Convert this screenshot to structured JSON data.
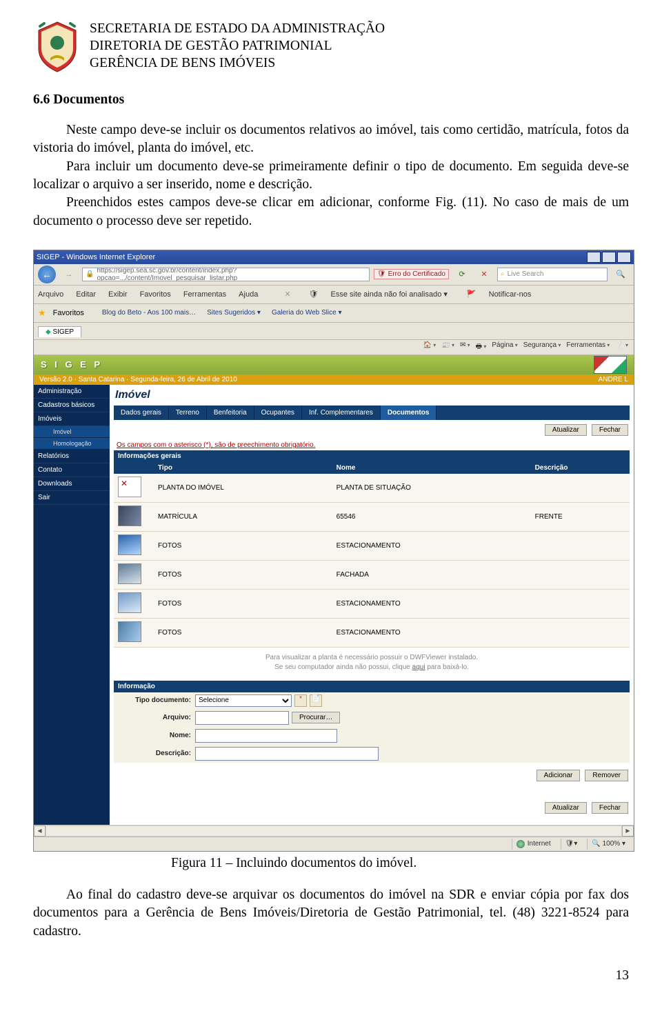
{
  "letterhead": {
    "line1": "SECRETARIA DE ESTADO DA ADMINISTRAÇÃO",
    "line2": "DIRETORIA DE GESTÃO PATRIMONIAL",
    "line3": "GERÊNCIA DE BENS IMÓVEIS"
  },
  "heading": "6.6 Documentos",
  "para1": "Neste campo deve-se incluir os documentos relativos ao imóvel, tais como certidão, matrícula, fotos da vistoria do imóvel, planta do imóvel, etc.",
  "para2a": "Para incluir um documento deve-se primeiramente definir o tipo de documento. Em seguida deve-se localizar o arquivo a ser inserido, nome e descrição.",
  "para2b": "Preenchidos estes campos deve-se clicar em adicionar, conforme Fig. (11). No caso de mais de um documento o processo deve ser repetido.",
  "caption": "Figura 11 – Incluindo documentos do imóvel.",
  "para3": "Ao final do cadastro deve-se arquivar os documentos do imóvel na SDR e enviar cópia por fax dos documentos para a Gerência de Bens Imóveis/Diretoria de Gestão Patrimonial, tel. (48) 3221-8524 para cadastro.",
  "pagenum": "13",
  "ie": {
    "title": "SIGEP - Windows Internet Explorer",
    "url": "https://sigep.sea.sc.gov.br/content/index.php?opcao=.../content/Imovel_pesquisar_listar.php",
    "cert": "Erro do Certificado",
    "search": "Live Search",
    "menu": {
      "arquivo": "Arquivo",
      "editar": "Editar",
      "exibir": "Exibir",
      "favoritos": "Favoritos",
      "ferramentas": "Ferramentas",
      "ajuda": "Ajuda"
    },
    "infobar": "Esse site ainda não foi analisado ▾",
    "notificar": "Notificar-nos",
    "favLabel": "Favoritos",
    "fav1": "Blog do Beto - Aos 100 mais…",
    "fav2": "Sites Sugeridos ▾",
    "fav3": "Galeria do Web Slice ▾",
    "tab": "SIGEP",
    "tools": {
      "pagina": "Página",
      "seguranca": "Segurança",
      "ferramentas": "Ferramentas"
    }
  },
  "sigep": {
    "brand": "S I G E P",
    "versionLine": "Versão 2.0  ·  Santa Catarina  ·  Segunda-feira, 26 de Abril de 2010",
    "user": "ANDRE L",
    "sidebar": [
      "Administração",
      "Cadastros básicos",
      "Imóveis",
      "Imóvel",
      "Homologação",
      "Relatórios",
      "Contato",
      "Downloads",
      "Sair"
    ],
    "pageTitle": "Imóvel",
    "tabs": [
      "Dados gerais",
      "Terreno",
      "Benfeitoria",
      "Ocupantes",
      "Inf. Complementares",
      "Documentos"
    ],
    "actions": {
      "atualizar": "Atualizar",
      "fechar": "Fechar"
    },
    "reqNote": "Os campos com o asterisco (*), são de preechimento obrigatório.",
    "sectInfo": "Informações gerais",
    "cols": {
      "tipo": "Tipo",
      "nome": "Nome",
      "descricao": "Descrição"
    },
    "rows": [
      {
        "tipo": "PLANTA DO IMÓVEL",
        "nome": "PLANTA DE SITUAÇÃO",
        "desc": ""
      },
      {
        "tipo": "MATRÍCULA",
        "nome": "65546",
        "desc": "FRENTE"
      },
      {
        "tipo": "FOTOS",
        "nome": "ESTACIONAMENTO",
        "desc": ""
      },
      {
        "tipo": "FOTOS",
        "nome": "FACHADA",
        "desc": ""
      },
      {
        "tipo": "FOTOS",
        "nome": "ESTACIONAMENTO",
        "desc": ""
      },
      {
        "tipo": "FOTOS",
        "nome": "ESTACIONAMENTO",
        "desc": ""
      }
    ],
    "viewerNote1": "Para visualizar a planta é necessário possuir o DWFViewer instalado.",
    "viewerNote2a": "Se seu computador ainda não possui, clique ",
    "viewerNote2link": "aqui",
    "viewerNote2b": " para baixá-lo.",
    "sectForm": "Informação",
    "labels": {
      "tipoDoc": "Tipo documento:",
      "arquivo": "Arquivo:",
      "nome": "Nome:",
      "descricao": "Descrição:"
    },
    "selectDefault": "Selecione",
    "procurar": "Procurar…",
    "add": "Adicionar",
    "rem": "Remover",
    "status": {
      "internet": "Internet",
      "zoom": "100%"
    }
  }
}
